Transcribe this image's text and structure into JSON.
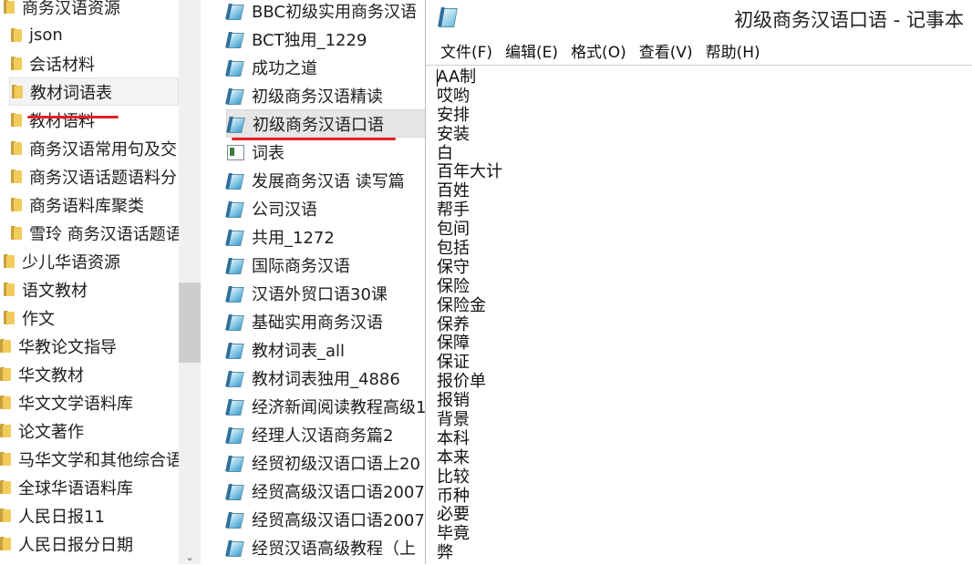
{
  "tree": {
    "items": [
      {
        "label": "商务汉语资源",
        "depth": 1
      },
      {
        "label": "json",
        "depth": 2
      },
      {
        "label": "会话材料",
        "depth": 2
      },
      {
        "label": "教材词语表",
        "depth": 2,
        "selected": true
      },
      {
        "label": "教材语料",
        "depth": 2
      },
      {
        "label": "商务汉语常用句及交",
        "depth": 2
      },
      {
        "label": "商务汉语话题语料分",
        "depth": 2
      },
      {
        "label": "商务语料库聚类",
        "depth": 2
      },
      {
        "label": "雪玲 商务汉语话题语",
        "depth": 2
      },
      {
        "label": "少儿华语资源",
        "depth": 1
      },
      {
        "label": "语文教材",
        "depth": 1
      },
      {
        "label": "作文",
        "depth": 1
      },
      {
        "label": "华教论文指导",
        "depth": 0
      },
      {
        "label": "华文教材",
        "depth": 0
      },
      {
        "label": "华文文学语料库",
        "depth": 0
      },
      {
        "label": "论文著作",
        "depth": 0
      },
      {
        "label": "马华文学和其他综合语",
        "depth": 0
      },
      {
        "label": "全球华语语料库",
        "depth": 0
      },
      {
        "label": "人民日报11",
        "depth": 0
      },
      {
        "label": "人民日报分日期",
        "depth": 0
      }
    ]
  },
  "files": {
    "items": [
      {
        "label": "BBC初级实用商务汉语",
        "icon": "notepad-icon"
      },
      {
        "label": "BCT独用_1229",
        "icon": "notepad-icon"
      },
      {
        "label": "成功之道",
        "icon": "notepad-icon"
      },
      {
        "label": "初级商务汉语精读",
        "icon": "notepad-icon"
      },
      {
        "label": "初级商务汉语口语",
        "icon": "notepad-icon",
        "selected": true
      },
      {
        "label": "词表",
        "icon": "document-icon"
      },
      {
        "label": "发展商务汉语 读写篇",
        "icon": "notepad-icon"
      },
      {
        "label": "公司汉语",
        "icon": "notepad-icon"
      },
      {
        "label": "共用_1272",
        "icon": "notepad-icon"
      },
      {
        "label": "国际商务汉语",
        "icon": "notepad-icon"
      },
      {
        "label": "汉语外贸口语30课",
        "icon": "notepad-icon"
      },
      {
        "label": "基础实用商务汉语",
        "icon": "notepad-icon"
      },
      {
        "label": "教材词表_all",
        "icon": "notepad-icon"
      },
      {
        "label": "教材词表独用_4886",
        "icon": "notepad-icon"
      },
      {
        "label": "经济新闻阅读教程高级1",
        "icon": "notepad-icon"
      },
      {
        "label": "经理人汉语商务篇2",
        "icon": "notepad-icon"
      },
      {
        "label": "经贸初级汉语口语上20",
        "icon": "notepad-icon"
      },
      {
        "label": "经贸高级汉语口语2007",
        "icon": "notepad-icon"
      },
      {
        "label": "经贸高级汉语口语2007",
        "icon": "notepad-icon"
      },
      {
        "label": "经贸汉语高级教程（上",
        "icon": "notepad-icon"
      }
    ]
  },
  "notepad": {
    "title": "初级商务汉语口语 - 记事本",
    "menu": [
      "文件(F)",
      "编辑(E)",
      "格式(O)",
      "查看(V)",
      "帮助(H)"
    ],
    "lines": [
      "AA制",
      "哎哟",
      "安排",
      "安装",
      "白",
      "百年大计",
      "百姓",
      "帮手",
      "包间",
      "包括",
      "保守",
      "保险",
      "保险金",
      "保养",
      "保障",
      "保证",
      "报价单",
      "报销",
      "背景",
      "本科",
      "本来",
      "比较",
      "币种",
      "必要",
      "毕竟",
      "弊"
    ]
  },
  "colors": {
    "highlight_underline": "#e62020",
    "folder": "#f2cc5b"
  }
}
